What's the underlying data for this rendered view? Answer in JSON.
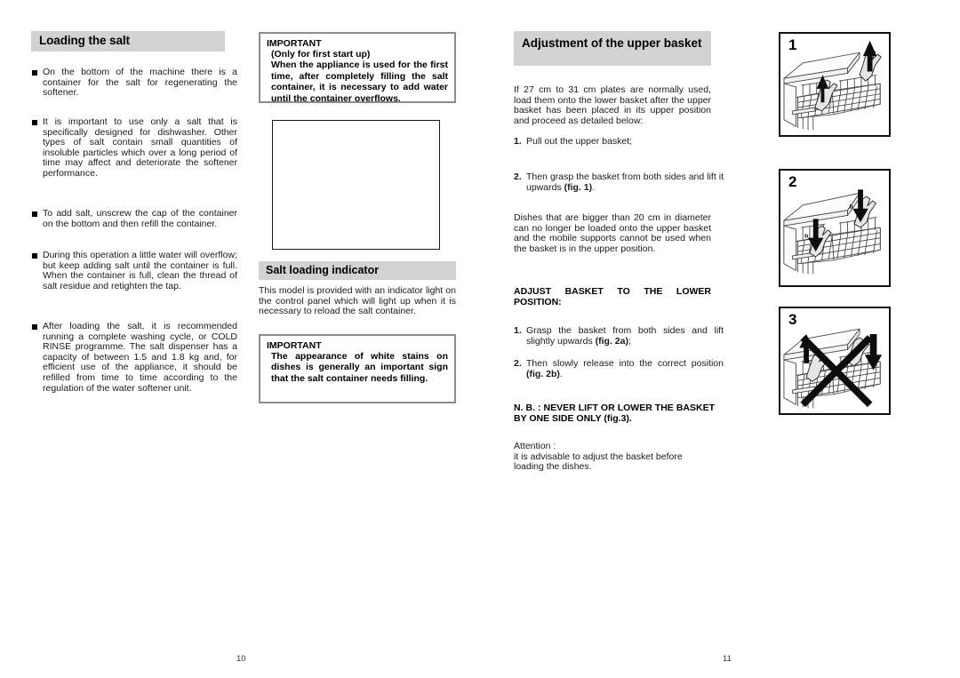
{
  "document": {
    "type": "dishwasher-instruction-manual-spread"
  },
  "left_page": {
    "page_number": "10",
    "column1": {
      "heading": "Loading the salt",
      "bullets": [
        "On the bottom of the machine there is a container for the salt for regenerating the softener.",
        "It is important to use only a salt that is specifically designed for dishwasher. Other types of salt contain small quantities of insoluble particles which over a long period of time may affect and deteriorate the softener performance.",
        "To add salt, unscrew the cap of the container on the bottom and then refill the container.",
        "During this operation a little water will overflow; but keep adding salt until the container is full. When the container is full, clean the thread of salt residue and retighten the tap.",
        "After loading the salt, it is recommended running a complete washing cycle, or COLD RINSE programme. The salt dispenser has a capacity of between 1.5 and 1.8 kg and, for efficient use of the appliance, it should be refilled from time to time according to the regulation of the water softener unit."
      ]
    },
    "column2": {
      "note_first_start": {
        "title": "IMPORTANT",
        "subtitle": "(Only for first start up)",
        "body": "When the appliance is used for the first time, after completely filling the salt container, it is necessary to add water until the container overflows."
      },
      "figure_box": {
        "caption": ""
      },
      "heading": "Salt loading indicator",
      "paragraph": "This model is provided with an indicator light on the control panel which will light up when it is necessary to reload the salt container.",
      "note_white_stains": {
        "title": "IMPORTANT",
        "body": "The appearance of white stains on dishes is generally an important sign that the salt container needs filling."
      }
    }
  },
  "right_page": {
    "page_number": "11",
    "heading": "Adjustment of the upper basket",
    "intro_paragraph": "If 27 cm to 31 cm plates are normally used, load them onto the lower basket after the upper basket has been placed in its upper position and proceed as detailed below:",
    "steps_upper": [
      {
        "num": "1.",
        "text": "Pull out the upper basket;"
      },
      {
        "num": "2.",
        "text_before": "Then grasp the basket from both sides and lift it upwards ",
        "emphasis": "(fig. 1)",
        "text_after": "."
      }
    ],
    "dishes_paragraph": "Dishes that are bigger than 20 cm in diameter can no longer be loaded onto the upper basket and the mobile supports cannot be used when the basket is in the upper position.",
    "subheading_adjust": "ADJUST BASKET TO THE LOWER POSITION:",
    "steps_lower": [
      {
        "num": "1.",
        "text_before": "Grasp the basket from both sides and lift slightly upwards ",
        "emphasis": "(fig. 2a)",
        "text_after": ";"
      },
      {
        "num": "2.",
        "text_before": "Then slowly release into the correct position ",
        "emphasis": "(fig. 2b)",
        "text_after": "."
      }
    ],
    "note_nb": "N. B. : NEVER  LIFT OR  LOWER THE BASKET  BY ONE SIDE ONLY (fig.3).",
    "attention_label": "Attention :",
    "attention_text": "it is advisable to adjust the basket before loading the dishes.",
    "figures": [
      {
        "number": "1",
        "description": "Upper basket lifted upwards with both hands, two up arrows",
        "labels": []
      },
      {
        "number": "2",
        "description": "Basket lowered into position, down arrows with a and b reference letters",
        "labels": [
          "a",
          "b",
          "a",
          "b"
        ]
      },
      {
        "number": "3",
        "description": "Crossed out illustration: never lift or lower the basket by one side only",
        "labels": []
      }
    ]
  },
  "colors": {
    "heading_bar": "#d2d2d2",
    "note_border": "#8c8c8c",
    "figure_border": "#111111",
    "text": "#1a1a1a",
    "page_background": "#ffffff"
  }
}
